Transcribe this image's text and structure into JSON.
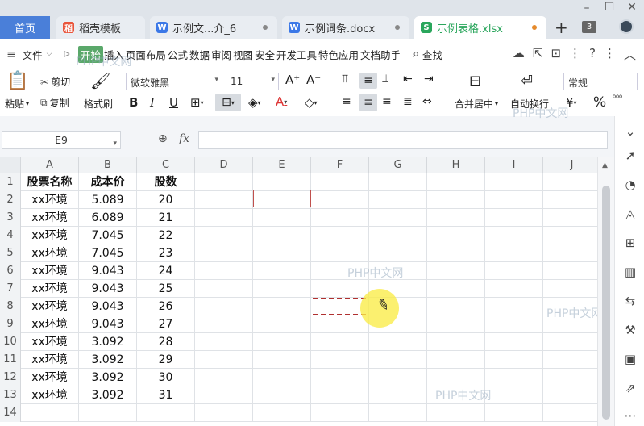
{
  "tabs": {
    "home": "首页",
    "docs": [
      {
        "label": "稻壳模板",
        "icon": "daoke-icon",
        "color": "#e9553b"
      },
      {
        "label": "示例文...介_6",
        "icon": "word-icon",
        "color": "#3b78e7"
      },
      {
        "label": "示例词条.docx",
        "icon": "word-icon",
        "color": "#3b78e7"
      },
      {
        "label": "示例表格.xlsx",
        "icon": "sheet-icon",
        "color": "#2aa65c"
      }
    ],
    "window_count": "3"
  },
  "menu": {
    "file": "文件",
    "items": [
      "开始",
      "插入",
      "页面布局",
      "公式",
      "数据",
      "审阅",
      "视图",
      "安全",
      "开发工具",
      "特色应用",
      "文档助手"
    ],
    "search": "查找"
  },
  "ribbon": {
    "paste": "粘贴",
    "cut": "剪切",
    "copy": "复制",
    "format_painter": "格式刷",
    "font_name": "微软雅黑",
    "font_size": "11",
    "merge_center": "合并居中",
    "wrap_text": "自动换行",
    "number_format": "常规"
  },
  "formula_bar": {
    "cell_ref": "E9",
    "fx": "fx",
    "value": ""
  },
  "sheet": {
    "columns": [
      "A",
      "B",
      "C",
      "D",
      "E",
      "F",
      "G",
      "H",
      "I",
      "J"
    ],
    "row_numbers": [
      "1",
      "2",
      "3",
      "4",
      "5",
      "6",
      "7",
      "8",
      "9",
      "10",
      "11",
      "12",
      "13",
      "14"
    ],
    "header": [
      "股票名称",
      "成本价",
      "股数"
    ],
    "rows": [
      [
        "xx环境",
        "5.089",
        "20"
      ],
      [
        "xx环境",
        "6.089",
        "21"
      ],
      [
        "xx环境",
        "7.045",
        "22"
      ],
      [
        "xx环境",
        "7.045",
        "23"
      ],
      [
        "xx环境",
        "9.043",
        "24"
      ],
      [
        "xx环境",
        "9.043",
        "25"
      ],
      [
        "xx环境",
        "9.043",
        "26"
      ],
      [
        "xx环境",
        "9.043",
        "27"
      ],
      [
        "xx环境",
        "3.092",
        "28"
      ],
      [
        "xx环境",
        "3.092",
        "29"
      ],
      [
        "xx环境",
        "3.092",
        "30"
      ],
      [
        "xx环境",
        "3.092",
        "31"
      ]
    ]
  },
  "watermarks": [
    "PHP中文网",
    "PHP中文网",
    "PHP中文网",
    "PHP中文网",
    "PHP中文网"
  ],
  "colors": {
    "accent": "#4a7fd9",
    "active_menu": "#5aa86a",
    "selection_border": "#c0504d",
    "highlight": "#faec46"
  }
}
